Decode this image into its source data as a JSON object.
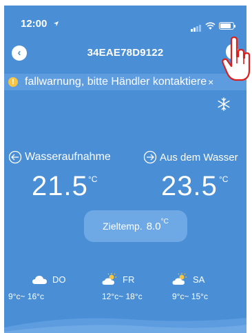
{
  "status_bar": {
    "time": "12:00",
    "icons": [
      "location-arrow-icon",
      "signal-icon",
      "wifi-icon",
      "battery-icon"
    ]
  },
  "header": {
    "device_id": "34EAE78D9122",
    "back_icon": "chevron-left-icon",
    "settings_icon": "info-icon"
  },
  "warning": {
    "text": "fallwarnung, bitte Händler kontaktiere",
    "close_label": "×",
    "icon": "exclamation-icon",
    "icon_color": "#f6c542"
  },
  "mode_icon": "snowflake-icon",
  "water_in": {
    "label": "Wasseraufnahme",
    "value": "21.5",
    "unit": "°C"
  },
  "water_out": {
    "label": "Aus dem Wasser",
    "value": "23.5",
    "unit": "°C"
  },
  "target": {
    "label": "Zieltemp.",
    "value": "8.0",
    "unit": "°C"
  },
  "forecast": [
    {
      "day": "DO",
      "range": "9°c~ 16°c",
      "icon": "cloud-icon"
    },
    {
      "day": "FR",
      "range": "12°c~ 18°c",
      "icon": "partly-sunny-icon"
    },
    {
      "day": "SA",
      "range": "9°c~ 15°c",
      "icon": "partly-sunny-icon"
    }
  ],
  "colors": {
    "background": "#4a8fd6",
    "pill": "#6ea9e6",
    "warning_bar": "#5e9ce0",
    "cursor": "#d9201c"
  }
}
